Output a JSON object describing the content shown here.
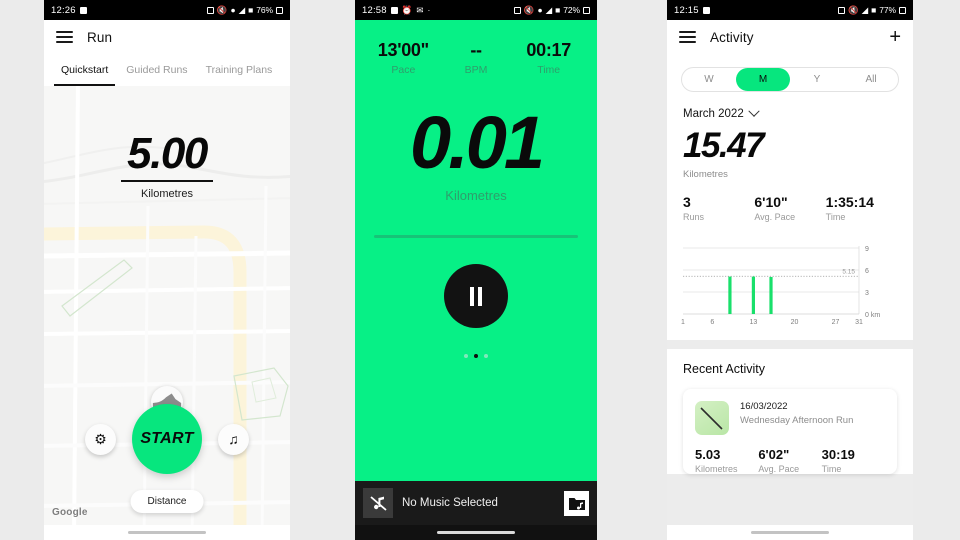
{
  "background_color": "#ebebeb",
  "accent_green": "#07E67E",
  "screens": [
    {
      "id": "run-quickstart",
      "statusbar": {
        "time": "12:26",
        "battery": "76%",
        "icons": [
          "nfc-icon",
          "mute-icon",
          "location-icon",
          "wifi-icon",
          "signal-icon",
          "battery-icon"
        ]
      },
      "appbar": {
        "title": "Run",
        "menu_icon": "hamburger-icon"
      },
      "tabs": [
        {
          "label": "Quickstart",
          "active": true
        },
        {
          "label": "Guided Runs",
          "active": false
        },
        {
          "label": "Training Plans",
          "active": false
        }
      ],
      "distance": {
        "value": "5.00",
        "unit": "Kilometres"
      },
      "map": {
        "attribution": "Google",
        "marker_icon": "shoe-icon",
        "position_icon": "red-dot-marker"
      },
      "controls": {
        "settings_icon": "gear-icon",
        "start_label": "START",
        "music_icon": "music-note-icon",
        "goal_pill": "Distance"
      }
    },
    {
      "id": "run-active",
      "statusbar": {
        "time": "12:58",
        "battery": "72%",
        "icons": [
          "save-icon",
          "clock-icon",
          "mail-icon",
          "dot-icon",
          "nfc-icon",
          "mute-icon",
          "location-icon",
          "wifi-icon",
          "signal-icon",
          "battery-icon"
        ]
      },
      "metrics": [
        {
          "value": "13'00\"",
          "label": "Pace"
        },
        {
          "value": "--",
          "label": "BPM"
        },
        {
          "value": "00:17",
          "label": "Time"
        }
      ],
      "distance": {
        "value": "0.01",
        "unit": "Kilometres"
      },
      "pause_button": {
        "icon": "pause-icon"
      },
      "page_dots": {
        "count": 3,
        "active_index": 1
      },
      "music_bar": {
        "text": "No Music Selected",
        "left_icon": "music-off-icon",
        "right_icon": "music-library-icon"
      }
    },
    {
      "id": "activity",
      "statusbar": {
        "time": "12:15",
        "battery": "77%",
        "icons": [
          "nfc-icon",
          "mute-icon",
          "wifi-icon",
          "signal-icon",
          "battery-icon"
        ]
      },
      "appbar": {
        "title": "Activity",
        "menu_icon": "hamburger-icon",
        "add_label": "+"
      },
      "segments": [
        {
          "label": "W",
          "active": false
        },
        {
          "label": "M",
          "active": true
        },
        {
          "label": "Y",
          "active": false
        },
        {
          "label": "All",
          "active": false
        }
      ],
      "period": "March 2022",
      "summary": {
        "total": "15.47",
        "unit": "Kilometres",
        "stats": [
          {
            "value": "3",
            "label": "Runs"
          },
          {
            "value": "6'10\"",
            "label": "Avg. Pace"
          },
          {
            "value": "1:35:14",
            "label": "Time"
          }
        ]
      },
      "recent": {
        "title": "Recent Activity",
        "items": [
          {
            "date": "16/03/2022",
            "name": "Wednesday Afternoon Run",
            "stats": [
              {
                "value": "5.03",
                "label": "Kilometres"
              },
              {
                "value": "6'02\"",
                "label": "Avg. Pace"
              },
              {
                "value": "30:19",
                "label": "Time"
              }
            ]
          }
        ]
      }
    }
  ],
  "chart_data": {
    "type": "bar",
    "title": "",
    "xlabel": "",
    "ylabel": "km",
    "categories": [
      1,
      6,
      13,
      20,
      27,
      31
    ],
    "x_tick_labels": [
      "1",
      "6",
      "13",
      "20",
      "27",
      "31"
    ],
    "y_tick_labels": [
      "0 km",
      "3",
      "6",
      "9"
    ],
    "y_ticks": [
      0,
      3,
      6,
      9
    ],
    "ylim": [
      0,
      9
    ],
    "xlim": [
      1,
      31
    ],
    "grid": true,
    "legend": "none",
    "bar_color": "#19E06B",
    "average_line": {
      "value": 5.15,
      "label": "5.15",
      "style": "dotted"
    },
    "bars": [
      {
        "day": 9,
        "value": 5.1
      },
      {
        "day": 13,
        "value": 5.1
      },
      {
        "day": 16,
        "value": 5.05
      }
    ]
  }
}
